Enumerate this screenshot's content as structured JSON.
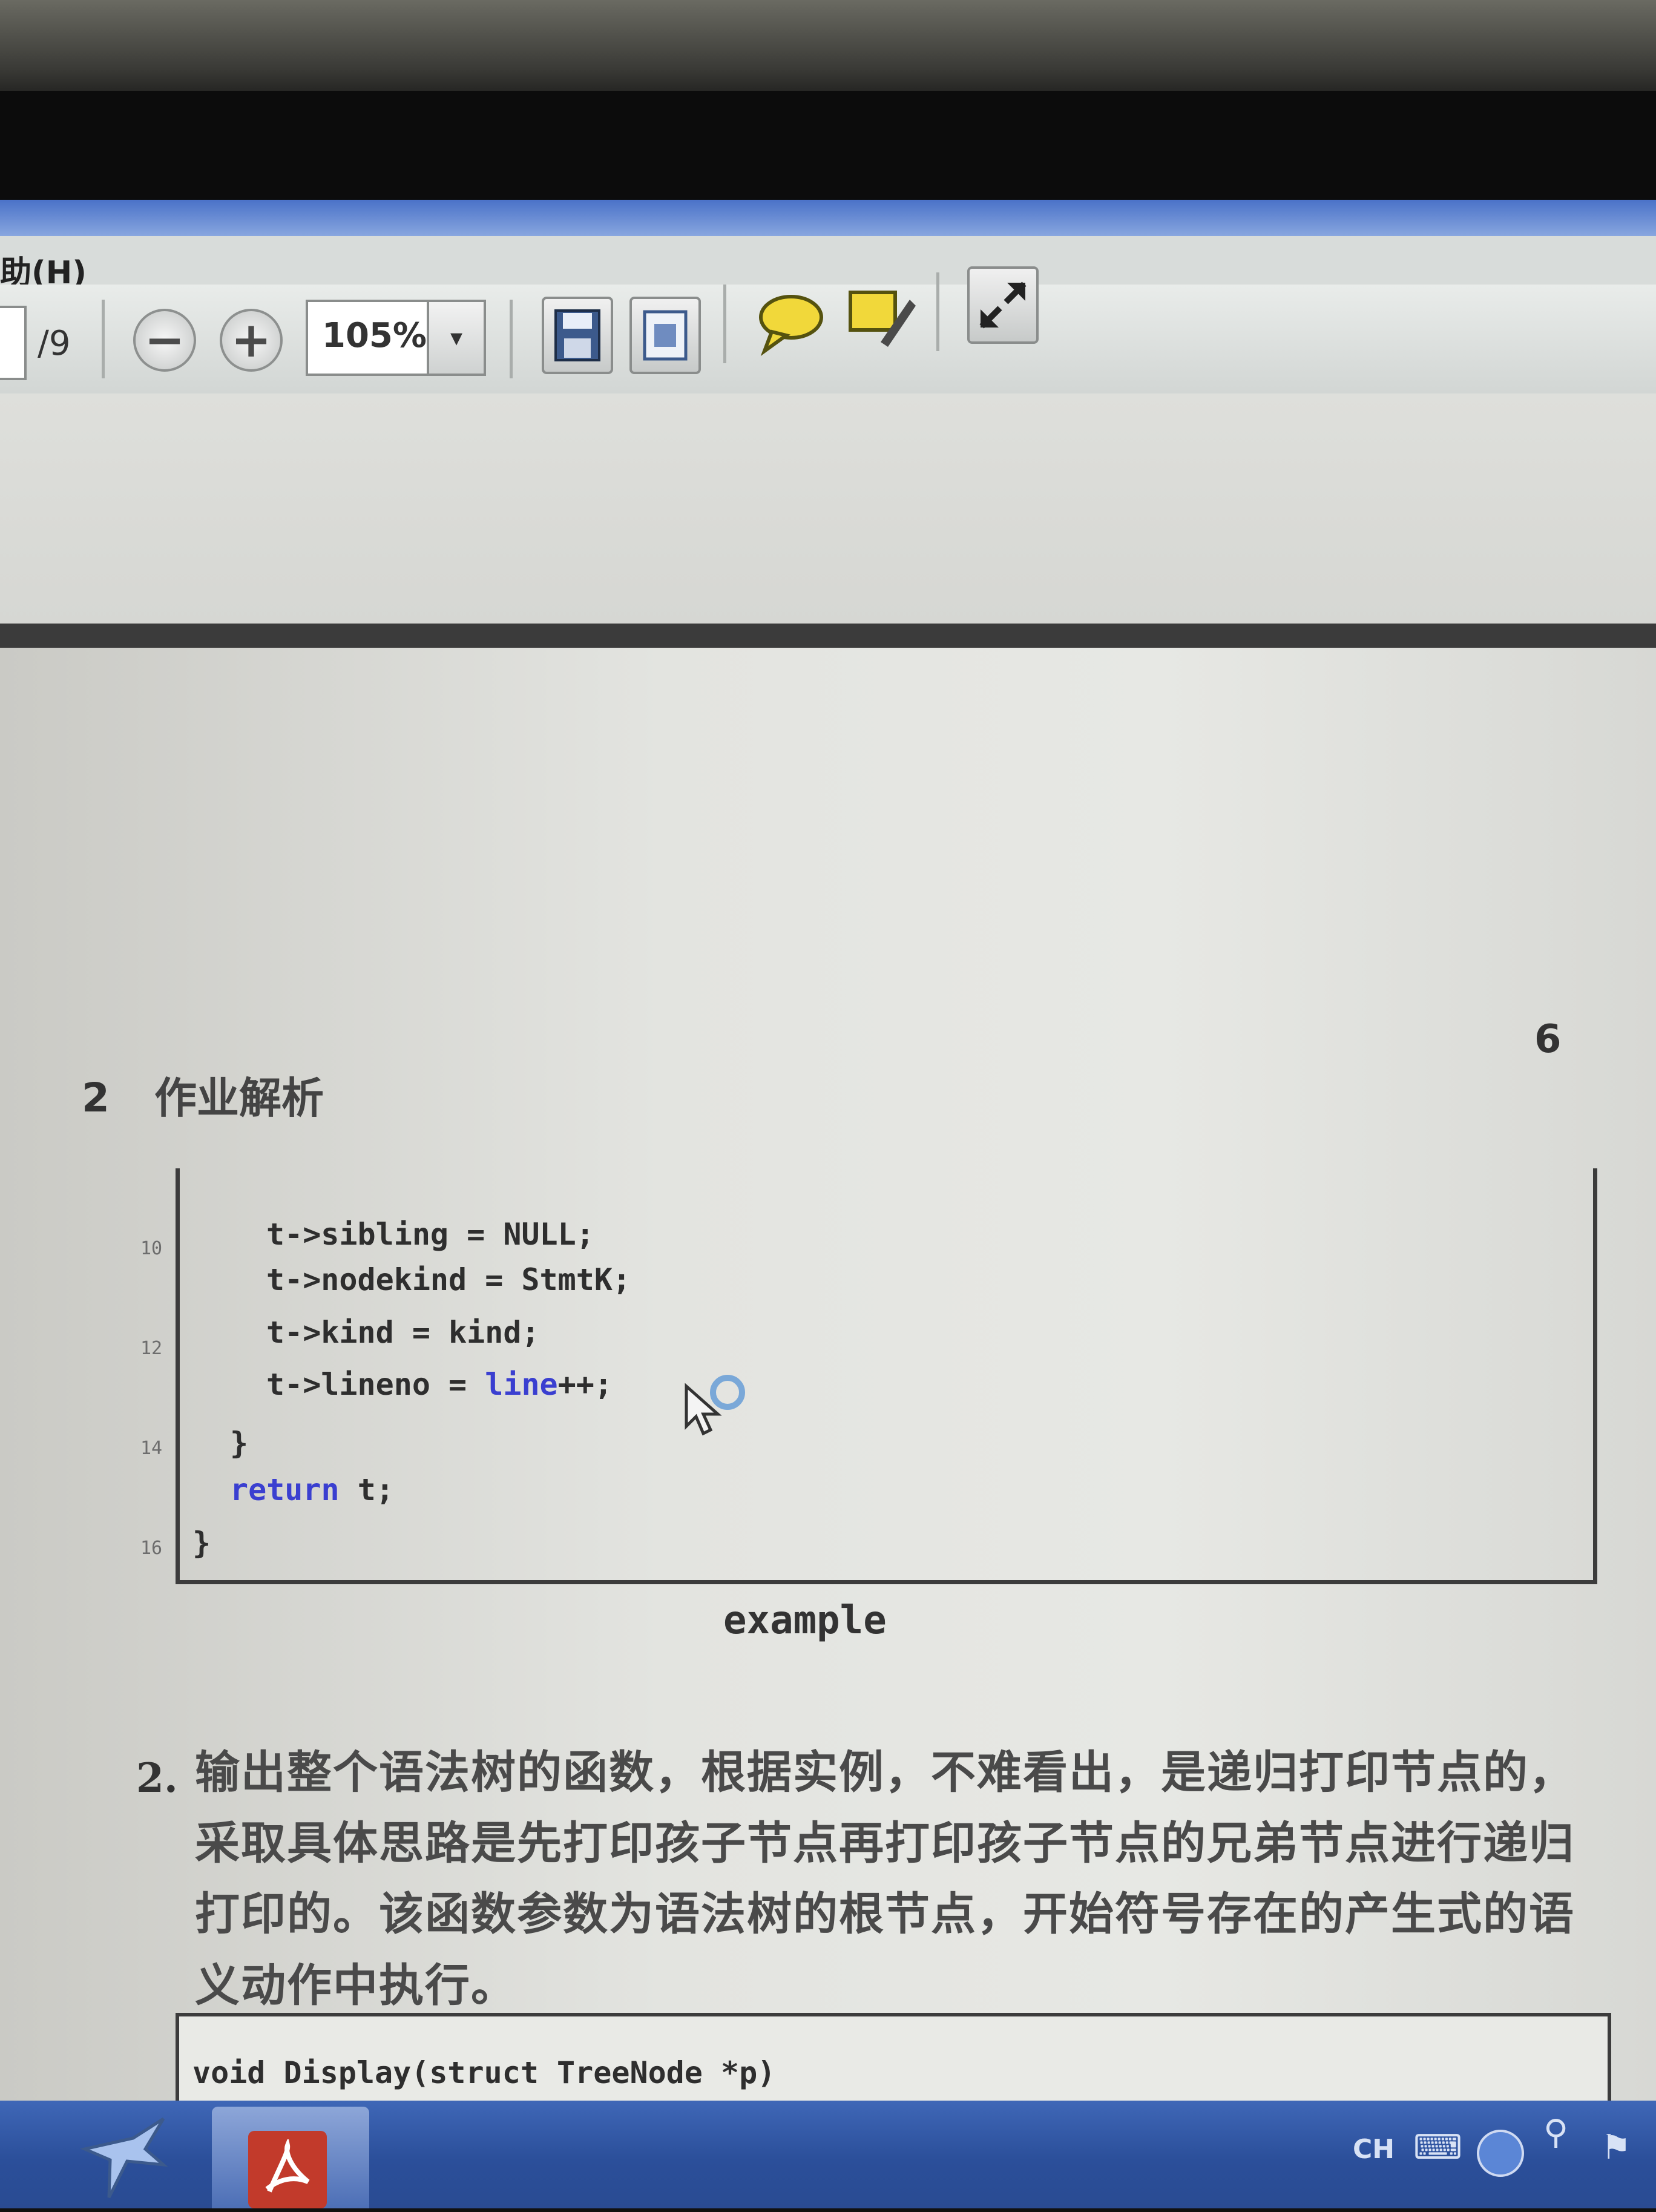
{
  "menu": {
    "help": "助(H)"
  },
  "toolbar": {
    "page_total": "/9",
    "zoom_out_glyph": "−",
    "zoom_in_glyph": "+",
    "zoom_value": "105%",
    "zoom_dropdown_glyph": "▾",
    "icons": [
      "zoom-out-icon",
      "zoom-in-icon",
      "save-icon",
      "fit-page-icon",
      "comment-icon",
      "sign-icon",
      "fullscreen-icon"
    ]
  },
  "document": {
    "page_number": "6",
    "section_number": "2",
    "section_title": "作业解析",
    "code_listing_1": {
      "line_numbers": [
        "10",
        "12",
        "14",
        "16"
      ],
      "lines": [
        {
          "text": "t->sibling = NULL;"
        },
        {
          "text": "t->nodekind = StmtK;"
        },
        {
          "text": "t->kind = kind;"
        },
        {
          "prefix": "t->lineno = ",
          "keyword": "line",
          "suffix": "++;"
        },
        {
          "text": "}"
        },
        {
          "keyword": "return",
          "suffix": " t;"
        },
        {
          "text": "}"
        }
      ]
    },
    "caption": "example",
    "item_number": "2.",
    "paragraph_lines": [
      "输出整个语法树的函数，根据实例，不难看出，是递归打印节点的，",
      "采取具体思路是先打印孩子节点再打印孩子节点的兄弟节点进行递归",
      "打印的。该函数参数为语法树的根节点，开始符号存在的产生式的语",
      "义动作中执行。"
    ],
    "code_listing_2": {
      "line": "void Display(struct TreeNode *p)"
    }
  },
  "taskbar": {
    "language": "CH",
    "tray_icons": [
      "keyboard-icon",
      "help-icon",
      "network-icon",
      "flag-icon"
    ]
  },
  "colors": {
    "taskbar": "#2b4f9a",
    "keyword": "#3a3fd0",
    "adobe_red": "#c23a2b"
  }
}
